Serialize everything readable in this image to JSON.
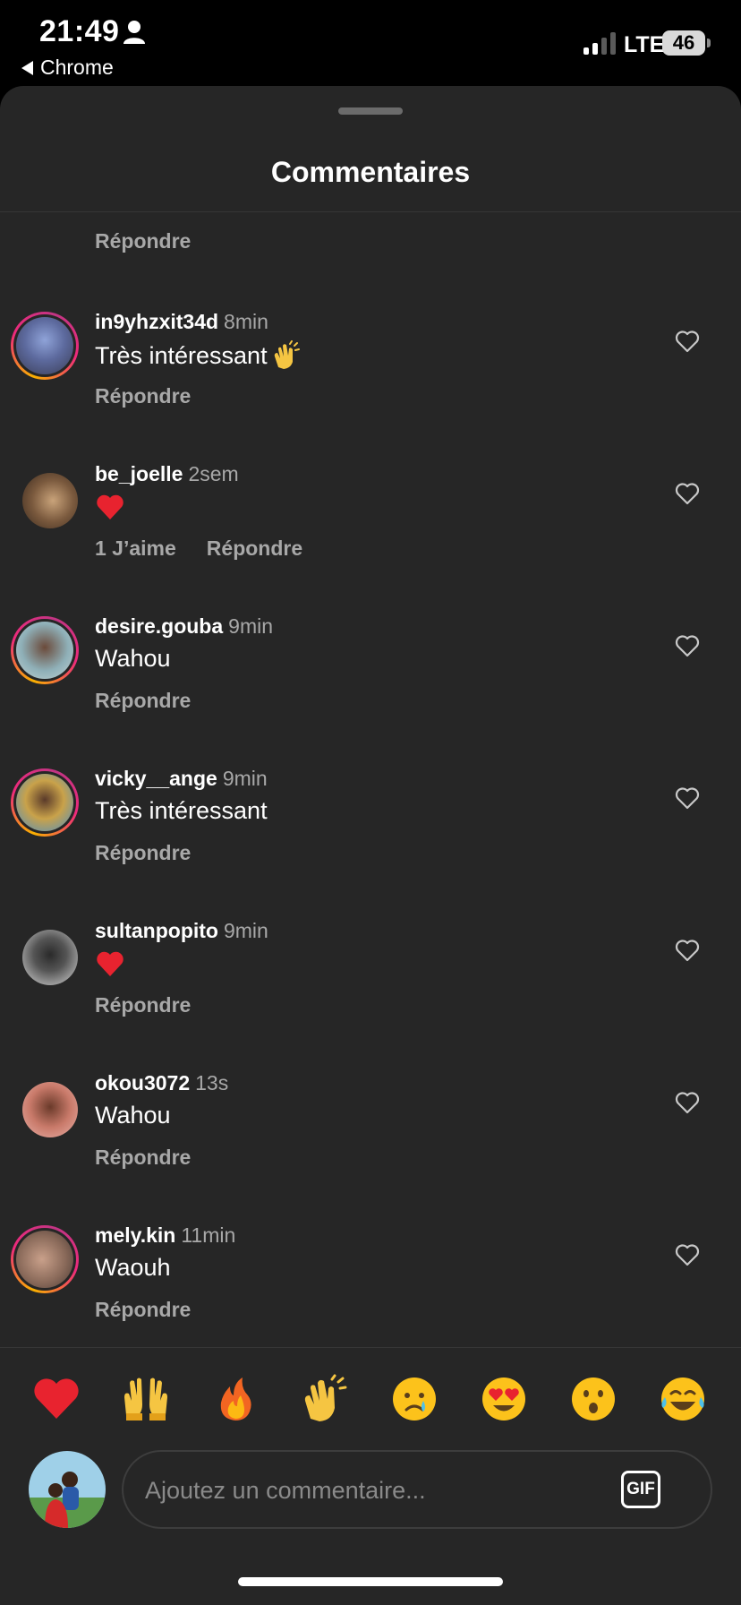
{
  "status_bar": {
    "time": "21:49",
    "back_app": "Chrome",
    "network": "LTE",
    "battery": "46",
    "icons": [
      "person-icon",
      "signal-icon",
      "battery-icon"
    ]
  },
  "sheet": {
    "title": "Commentaires",
    "partial_reply": "Répondre"
  },
  "comments": [
    {
      "username": "in9yhzxit34d",
      "time": "8min",
      "text": "Très intéressant",
      "emoji": "clapping-hands-emoji",
      "reply": "Répondre",
      "likes": "",
      "ring": true
    },
    {
      "username": "be_joelle",
      "time": "2sem",
      "text": "",
      "emoji": "red-heart-emoji",
      "reply": "Répondre",
      "likes": "1 J’aime",
      "ring": false
    },
    {
      "username": "desire.gouba",
      "time": "9min",
      "text": "Wahou",
      "emoji": "",
      "reply": "Répondre",
      "likes": "",
      "ring": true
    },
    {
      "username": "vicky__ange",
      "time": "9min",
      "text": "Très intéressant",
      "emoji": "",
      "reply": "Répondre",
      "likes": "",
      "ring": true
    },
    {
      "username": "sultanpopito",
      "time": "9min",
      "text": "",
      "emoji": "red-heart-emoji",
      "reply": "Répondre",
      "likes": "",
      "ring": false
    },
    {
      "username": "okou3072",
      "time": "13s",
      "text": "Wahou",
      "emoji": "",
      "reply": "Répondre",
      "likes": "",
      "ring": false
    },
    {
      "username": "mely.kin",
      "time": "11min",
      "text": "Waouh",
      "emoji": "",
      "reply": "Répondre",
      "likes": "",
      "ring": true
    }
  ],
  "reactions": [
    "red-heart",
    "raising-hands",
    "fire",
    "clapping-hands",
    "crying-face",
    "heart-eyes",
    "surprised-face",
    "tears-of-joy"
  ],
  "composer": {
    "placeholder": "Ajoutez un commentaire...",
    "gif_label": "GIF"
  },
  "colors": {
    "sheet_bg": "#262626",
    "secondary_text": "#a8a8a8",
    "ring_start": "#f9b000",
    "ring_end": "#c13584"
  }
}
